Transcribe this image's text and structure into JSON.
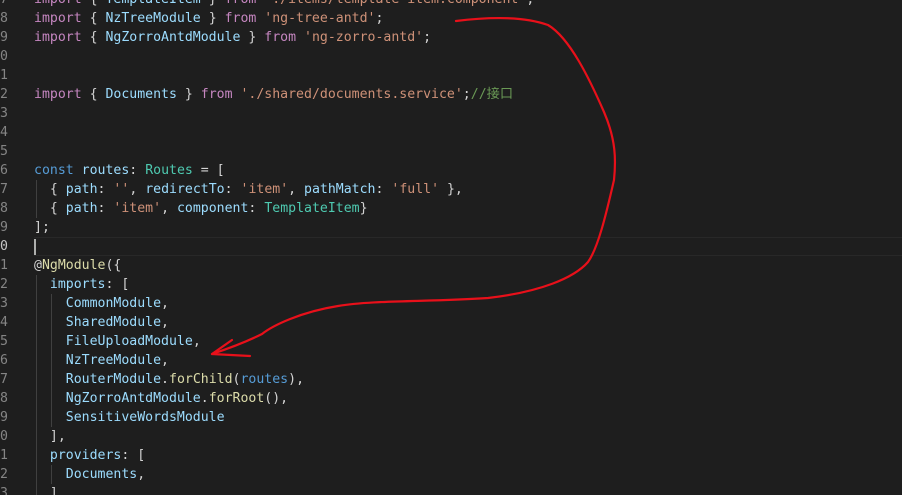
{
  "editor": {
    "colors": {
      "background": "#1e1e1e",
      "keyword_import": "#c586c0",
      "keyword": "#569cd6",
      "identifier": "#9cdcfe",
      "type": "#4ec9b0",
      "string": "#ce9178",
      "comment": "#6a9955",
      "function": "#dcdcaa",
      "punctuation": "#d4d4d4",
      "line_number": "#858585",
      "annotation": "#e8101a"
    },
    "annotation": {
      "description_icon": "hand-drawn-red-arrow",
      "from_line": "8",
      "to_line": "6"
    },
    "current_line": "0",
    "lines": [
      {
        "num": "7",
        "guides": 0,
        "tokens": [
          {
            "t": "import",
            "c": "keyword_import"
          },
          {
            "t": " { ",
            "c": "punctuation"
          },
          {
            "t": "TemplateItem",
            "c": "identifier"
          },
          {
            "t": " } ",
            "c": "punctuation"
          },
          {
            "t": "from",
            "c": "keyword_import"
          },
          {
            "t": " ",
            "c": "punctuation"
          },
          {
            "t": "'./items/template-item.component'",
            "c": "string"
          },
          {
            "t": ";",
            "c": "punctuation"
          }
        ]
      },
      {
        "num": "8",
        "guides": 0,
        "tokens": [
          {
            "t": "import",
            "c": "keyword_import"
          },
          {
            "t": " { ",
            "c": "punctuation"
          },
          {
            "t": "NzTreeModule",
            "c": "identifier"
          },
          {
            "t": " } ",
            "c": "punctuation"
          },
          {
            "t": "from",
            "c": "keyword_import"
          },
          {
            "t": " ",
            "c": "punctuation"
          },
          {
            "t": "'ng-tree-antd'",
            "c": "string"
          },
          {
            "t": ";",
            "c": "punctuation"
          }
        ]
      },
      {
        "num": "9",
        "guides": 0,
        "tokens": [
          {
            "t": "import",
            "c": "keyword_import"
          },
          {
            "t": " { ",
            "c": "punctuation"
          },
          {
            "t": "NgZorroAntdModule",
            "c": "identifier"
          },
          {
            "t": " } ",
            "c": "punctuation"
          },
          {
            "t": "from",
            "c": "keyword_import"
          },
          {
            "t": " ",
            "c": "punctuation"
          },
          {
            "t": "'ng-zorro-antd'",
            "c": "string"
          },
          {
            "t": ";",
            "c": "punctuation"
          }
        ]
      },
      {
        "num": "0",
        "guides": 0,
        "tokens": []
      },
      {
        "num": "1",
        "guides": 0,
        "tokens": []
      },
      {
        "num": "2",
        "guides": 0,
        "tokens": [
          {
            "t": "import",
            "c": "keyword_import"
          },
          {
            "t": " { ",
            "c": "punctuation"
          },
          {
            "t": "Documents",
            "c": "identifier"
          },
          {
            "t": " } ",
            "c": "punctuation"
          },
          {
            "t": "from",
            "c": "keyword_import"
          },
          {
            "t": " ",
            "c": "punctuation"
          },
          {
            "t": "'./shared/documents.service'",
            "c": "string"
          },
          {
            "t": ";",
            "c": "punctuation"
          },
          {
            "t": "//接口",
            "c": "comment"
          }
        ]
      },
      {
        "num": "3",
        "guides": 0,
        "tokens": []
      },
      {
        "num": "4",
        "guides": 0,
        "tokens": []
      },
      {
        "num": "5",
        "guides": 0,
        "tokens": []
      },
      {
        "num": "6",
        "guides": 0,
        "tokens": [
          {
            "t": "const",
            "c": "keyword"
          },
          {
            "t": " ",
            "c": "punctuation"
          },
          {
            "t": "routes",
            "c": "identifier"
          },
          {
            "t": ": ",
            "c": "punctuation"
          },
          {
            "t": "Routes",
            "c": "type"
          },
          {
            "t": " = [",
            "c": "punctuation"
          }
        ]
      },
      {
        "num": "7",
        "guides": 1,
        "tokens": [
          {
            "t": "  { ",
            "c": "punctuation"
          },
          {
            "t": "path",
            "c": "identifier"
          },
          {
            "t": ": ",
            "c": "punctuation"
          },
          {
            "t": "''",
            "c": "string"
          },
          {
            "t": ", ",
            "c": "punctuation"
          },
          {
            "t": "redirectTo",
            "c": "identifier"
          },
          {
            "t": ": ",
            "c": "punctuation"
          },
          {
            "t": "'item'",
            "c": "string"
          },
          {
            "t": ", ",
            "c": "punctuation"
          },
          {
            "t": "pathMatch",
            "c": "identifier"
          },
          {
            "t": ": ",
            "c": "punctuation"
          },
          {
            "t": "'full'",
            "c": "string"
          },
          {
            "t": " },",
            "c": "punctuation"
          }
        ]
      },
      {
        "num": "8",
        "guides": 1,
        "tokens": [
          {
            "t": "  { ",
            "c": "punctuation"
          },
          {
            "t": "path",
            "c": "identifier"
          },
          {
            "t": ": ",
            "c": "punctuation"
          },
          {
            "t": "'item'",
            "c": "string"
          },
          {
            "t": ", ",
            "c": "punctuation"
          },
          {
            "t": "component",
            "c": "identifier"
          },
          {
            "t": ": ",
            "c": "punctuation"
          },
          {
            "t": "TemplateItem",
            "c": "type"
          },
          {
            "t": "}",
            "c": "punctuation"
          }
        ]
      },
      {
        "num": "9",
        "guides": 0,
        "tokens": [
          {
            "t": "];",
            "c": "punctuation"
          }
        ]
      },
      {
        "num": "0",
        "guides": 0,
        "current": true,
        "tokens": []
      },
      {
        "num": "1",
        "guides": 0,
        "tokens": [
          {
            "t": "@",
            "c": "punctuation"
          },
          {
            "t": "NgModule",
            "c": "function"
          },
          {
            "t": "({",
            "c": "punctuation"
          }
        ]
      },
      {
        "num": "2",
        "guides": 1,
        "tokens": [
          {
            "t": "  ",
            "c": "punctuation"
          },
          {
            "t": "imports",
            "c": "identifier"
          },
          {
            "t": ": [",
            "c": "punctuation"
          }
        ]
      },
      {
        "num": "3",
        "guides": 2,
        "tokens": [
          {
            "t": "    ",
            "c": "punctuation"
          },
          {
            "t": "CommonModule",
            "c": "identifier"
          },
          {
            "t": ",",
            "c": "punctuation"
          }
        ]
      },
      {
        "num": "4",
        "guides": 2,
        "tokens": [
          {
            "t": "    ",
            "c": "punctuation"
          },
          {
            "t": "SharedModule",
            "c": "identifier"
          },
          {
            "t": ",",
            "c": "punctuation"
          }
        ]
      },
      {
        "num": "5",
        "guides": 2,
        "tokens": [
          {
            "t": "    ",
            "c": "punctuation"
          },
          {
            "t": "FileUploadModule",
            "c": "identifier"
          },
          {
            "t": ",",
            "c": "punctuation"
          }
        ]
      },
      {
        "num": "6",
        "guides": 2,
        "tokens": [
          {
            "t": "    ",
            "c": "punctuation"
          },
          {
            "t": "NzTreeModule",
            "c": "identifier"
          },
          {
            "t": ",",
            "c": "punctuation"
          }
        ]
      },
      {
        "num": "7",
        "guides": 2,
        "tokens": [
          {
            "t": "    ",
            "c": "punctuation"
          },
          {
            "t": "RouterModule",
            "c": "identifier"
          },
          {
            "t": ".",
            "c": "punctuation"
          },
          {
            "t": "forChild",
            "c": "function"
          },
          {
            "t": "(",
            "c": "punctuation"
          },
          {
            "t": "routes",
            "c": "keyword"
          },
          {
            "t": "),",
            "c": "punctuation"
          }
        ]
      },
      {
        "num": "8",
        "guides": 2,
        "tokens": [
          {
            "t": "    ",
            "c": "punctuation"
          },
          {
            "t": "NgZorroAntdModule",
            "c": "identifier"
          },
          {
            "t": ".",
            "c": "punctuation"
          },
          {
            "t": "forRoot",
            "c": "function"
          },
          {
            "t": "(),",
            "c": "punctuation"
          }
        ]
      },
      {
        "num": "9",
        "guides": 2,
        "tokens": [
          {
            "t": "    ",
            "c": "punctuation"
          },
          {
            "t": "SensitiveWordsModule",
            "c": "identifier"
          }
        ]
      },
      {
        "num": "0",
        "guides": 1,
        "tokens": [
          {
            "t": "  ],",
            "c": "punctuation"
          }
        ]
      },
      {
        "num": "1",
        "guides": 1,
        "tokens": [
          {
            "t": "  ",
            "c": "punctuation"
          },
          {
            "t": "providers",
            "c": "identifier"
          },
          {
            "t": ": [",
            "c": "punctuation"
          }
        ]
      },
      {
        "num": "2",
        "guides": 2,
        "tokens": [
          {
            "t": "    ",
            "c": "punctuation"
          },
          {
            "t": "Documents",
            "c": "identifier"
          },
          {
            "t": ",",
            "c": "punctuation"
          }
        ]
      },
      {
        "num": "3",
        "guides": 1,
        "tokens": [
          {
            "t": "  ],",
            "c": "punctuation"
          }
        ]
      }
    ]
  }
}
